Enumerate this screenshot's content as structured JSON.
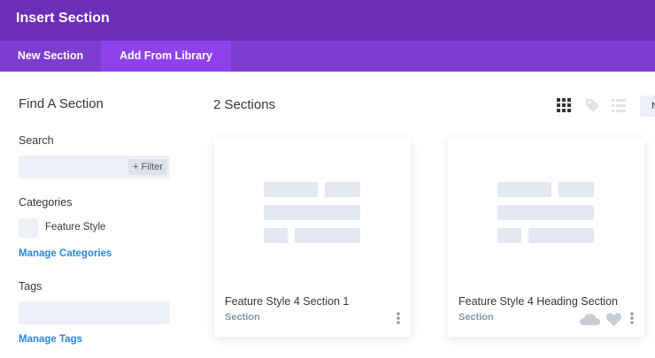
{
  "window": {
    "title": "Insert Section"
  },
  "tabs": [
    {
      "label": "New Section"
    },
    {
      "label": "Add From Library",
      "active": true
    }
  ],
  "sidebar": {
    "title": "Find A Section",
    "search_label": "Search",
    "search_value": "",
    "filter_label": "+ Filter",
    "categories_label": "Categories",
    "category_item": "Feature Style",
    "manage_categories": "Manage Categories",
    "tags_label": "Tags",
    "tags_value": "",
    "manage_tags": "Manage Tags"
  },
  "main": {
    "count": "2 Sections",
    "view_icons": [
      "grid-view-icon",
      "tag-icon",
      "list-view-icon"
    ],
    "cards": [
      {
        "title": "Feature Style 4 Section 1",
        "subtitle": "Section"
      },
      {
        "title": "Feature Style 4 Heading Section",
        "subtitle": "Section"
      }
    ]
  },
  "colors": {
    "titlebar": "#6c2eb9",
    "tabbar": "#7e3bd0",
    "active_tab": "#8f42ec",
    "link": "#2b87da",
    "placeholder": "#e3e8f0"
  }
}
